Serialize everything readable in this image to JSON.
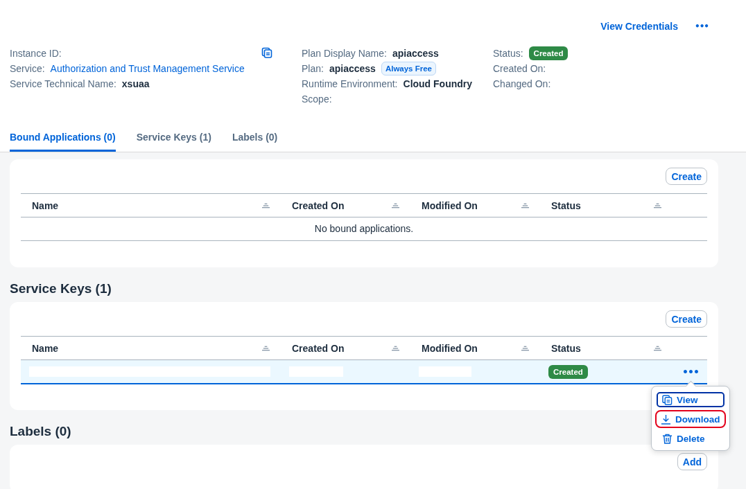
{
  "header": {
    "actions": [
      {
        "kind": "link",
        "label": "View Credentials"
      },
      {
        "kind": "more",
        "label": "•••"
      }
    ],
    "columns": [
      [
        {
          "label": "Instance ID:",
          "kind": "copy"
        },
        {
          "label": "Service:",
          "value": "Authorization and Trust Management Service",
          "kind": "link"
        },
        {
          "label": "Service Technical Name:",
          "value": "xsuaa",
          "kind": "strong"
        }
      ],
      [
        {
          "label": "Plan Display Name:",
          "value": "apiaccess",
          "kind": "strong"
        },
        {
          "label": "Plan:",
          "value": "apiaccess",
          "tag": "Always Free",
          "kind": "strong"
        },
        {
          "label": "Runtime Environment:",
          "value": "Cloud Foundry",
          "kind": "strong"
        },
        {
          "label": "Scope:",
          "kind": "plain"
        }
      ],
      [
        {
          "label": "Status:",
          "value": "Created",
          "kind": "status"
        },
        {
          "label": "Created On:",
          "kind": "plain"
        },
        {
          "label": "Changed On:",
          "kind": "plain"
        }
      ]
    ]
  },
  "tabs": [
    {
      "label": "Bound Applications (0)",
      "selected": true
    },
    {
      "label": "Service Keys (1)",
      "selected": false
    },
    {
      "label": "Labels (0)",
      "selected": false
    }
  ],
  "sections": [
    {
      "button": "Create",
      "columns": [
        "Name",
        "Created On",
        "Modified On",
        "Status"
      ],
      "empty_text": "No bound applications."
    },
    {
      "title": "Service Keys (1)",
      "button": "Create",
      "columns": [
        "Name",
        "Created On",
        "Modified On",
        "Status"
      ],
      "rows": [
        {
          "selected": true,
          "cells": [
            {
              "kind": "redacted"
            },
            {
              "kind": "redacted"
            },
            {
              "kind": "redacted"
            },
            {
              "kind": "status",
              "text": "Created"
            }
          ],
          "more": "•••"
        }
      ]
    },
    {
      "title": "Labels (0)",
      "button": "Add"
    }
  ],
  "menu": [
    {
      "label": "View",
      "kind": "view",
      "focused": true,
      "annotated": false
    },
    {
      "label": "Download",
      "kind": "download",
      "focused": false,
      "annotated": true
    },
    {
      "label": "Delete",
      "kind": "delete",
      "focused": false,
      "annotated": false
    }
  ]
}
